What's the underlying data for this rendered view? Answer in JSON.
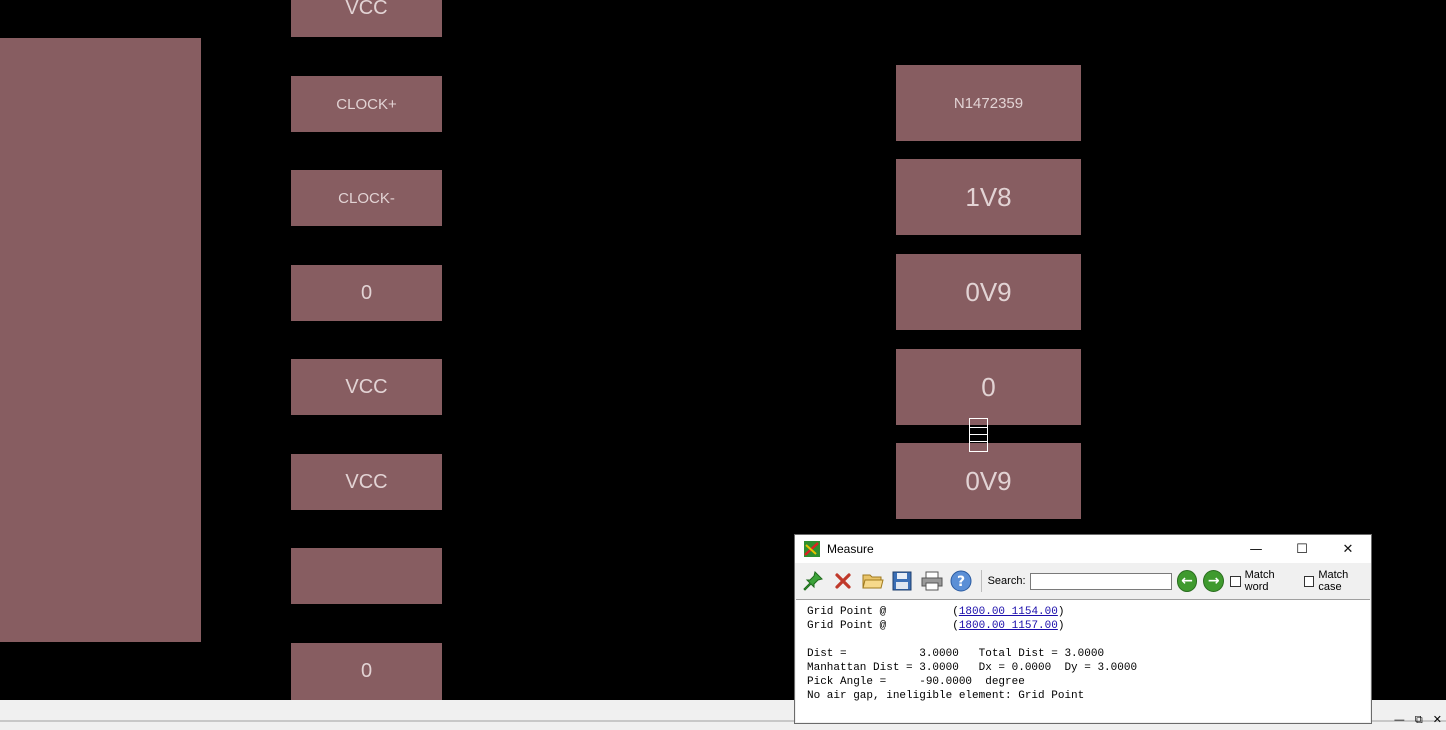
{
  "canvas": {
    "pads_left": [
      "VCC",
      "CLOCK+",
      "CLOCK-",
      "0",
      "VCC",
      "VCC",
      "",
      "0"
    ],
    "pads_right": [
      "N1472359",
      "1V8",
      "0V9",
      "0",
      "0V9"
    ],
    "pad_color": "#875d61",
    "pad_text_color": "#e2d3d4",
    "background_color": "#000000"
  },
  "dialog": {
    "title": "Measure",
    "controls": {
      "minimize": "—",
      "maximize": "☐",
      "close": "✕"
    },
    "toolbar": {
      "icons": [
        "pin-icon",
        "delete-icon",
        "open-folder-icon",
        "save-icon",
        "print-icon",
        "help-icon"
      ],
      "search_label": "Search:",
      "search_value": "",
      "match_word_label": "Match word",
      "match_case_label": "Match case"
    },
    "output": {
      "gp1_label": "Grid Point @          (",
      "gp1_link": "1800.00 1154.00",
      "gp1_end": ")",
      "gp2_label": "Grid Point @          (",
      "gp2_link": "1800.00 1157.00",
      "gp2_end": ")",
      "dist_line": "Dist =           3.0000   Total Dist = 3.0000",
      "manhattan_line": "Manhattan Dist = 3.0000   Dx = 0.0000  Dy = 3.0000",
      "angle_line": "Pick Angle =     -90.0000  degree",
      "airgap_line": "No air gap, ineligible element: Grid Point"
    }
  },
  "window_controls": {
    "minimize": "—",
    "restore": "⧉",
    "close": "✕"
  }
}
